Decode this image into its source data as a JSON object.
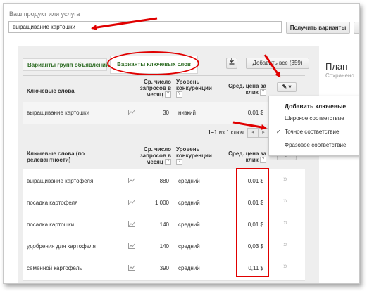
{
  "product": {
    "label": "Ваш продукт или услуга",
    "query": "выращивание картошки",
    "get_button": "Получить варианты",
    "extra_button": "I"
  },
  "tabs": {
    "ad_groups": "Варианты групп объявлений",
    "keywords": "Варианты ключевых слов"
  },
  "toolbar": {
    "download_icon": "download-icon",
    "add_all": "Добавить все (359)"
  },
  "plan": {
    "title": "План",
    "subtitle": "Сохранено"
  },
  "table1": {
    "headers": {
      "keyword": "Ключевые слова",
      "searches": "Ср. число запросов в месяц",
      "competition": "Уровень конкуренции",
      "cpc": "Сред. цена за клик"
    },
    "row": {
      "keyword": "выращивание картошки",
      "searches": "30",
      "competition": "низкий",
      "cpc": "0,01 $"
    }
  },
  "pager": {
    "range": "1–1",
    "of": "из",
    "count": "1",
    "unit": "ключ. сл."
  },
  "dropdown": {
    "header": "Добавить ключевые",
    "items": [
      "Широкое соответствие",
      "Точное соответствие",
      "Фразовое соответствие"
    ],
    "selected_index": 1
  },
  "table2": {
    "headers": {
      "keyword": "Ключевые слова (по релевантности)",
      "searches": "Ср. число запросов в месяц",
      "competition": "Уровень конкуренции",
      "cpc": "Сред. цена за клик"
    },
    "rows": [
      {
        "keyword": "выращивание картофеля",
        "searches": "880",
        "competition": "средний",
        "cpc": "0,01 $"
      },
      {
        "keyword": "посадка картофеля",
        "searches": "1 000",
        "competition": "средний",
        "cpc": "0,01 $"
      },
      {
        "keyword": "посадка картошки",
        "searches": "140",
        "competition": "средний",
        "cpc": "0,01 $"
      },
      {
        "keyword": "удобрения для картофеля",
        "searches": "140",
        "competition": "средний",
        "cpc": "0,03 $"
      },
      {
        "keyword": "семенной картофель",
        "searches": "390",
        "competition": "средний",
        "cpc": "0,11 $"
      }
    ]
  },
  "icons": {
    "help": "?",
    "chevron": "»",
    "pencil": "✎",
    "check": "✓"
  },
  "annotation_color": "#e00000"
}
